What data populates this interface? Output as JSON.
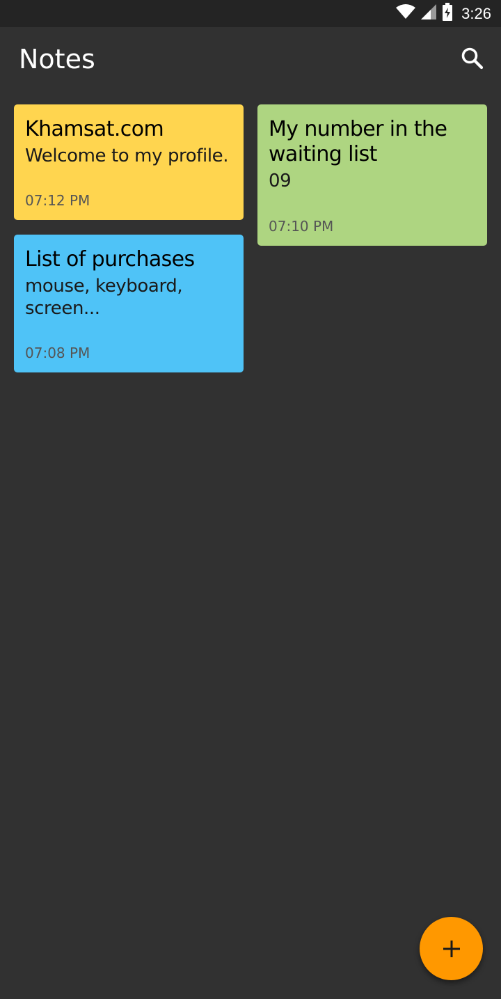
{
  "status_bar": {
    "time": "3:26",
    "icons": [
      "wifi-icon",
      "signal-icon",
      "battery-charging-icon"
    ]
  },
  "app_bar": {
    "title": "Notes",
    "search_icon": "search-icon"
  },
  "notes": [
    {
      "title": "Khamsat.com",
      "body": "Welcome to my profile.",
      "time": "07:12 PM",
      "color": "#FFD54F"
    },
    {
      "title": "My number in the waiting list",
      "body": "09",
      "time": "07:10 PM",
      "color": "#AED581"
    },
    {
      "title": "List of purchases",
      "body": "mouse, keyboard, screen...",
      "time": "07:08 PM",
      "color": "#4FC3F7"
    }
  ],
  "fab": {
    "icon": "plus-icon",
    "color": "#FF9800"
  },
  "colors": {
    "background": "#313131",
    "status_bar": "#242424"
  }
}
